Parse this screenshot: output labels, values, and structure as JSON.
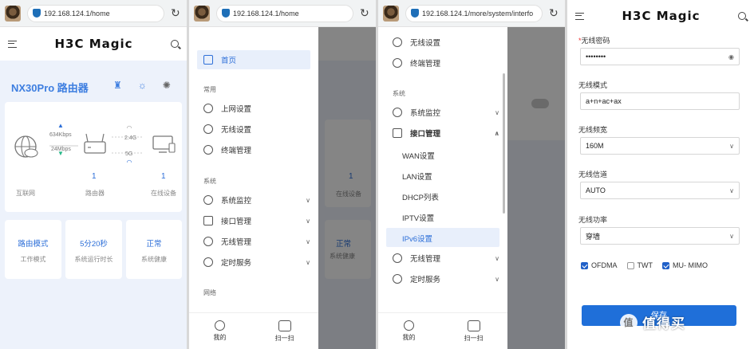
{
  "panel1": {
    "url": "192.168.124.1/home",
    "logo": "H3C Magic",
    "router_name": "NX30Pro 路由器",
    "upload_speed": "634Kbps",
    "download_speed": "24Mbps",
    "band_24": "2.4G",
    "band_5": "5G",
    "router_count": "1",
    "device_count": "1",
    "labels": {
      "internet": "互联网",
      "router": "路由器",
      "online": "在线设备"
    },
    "stats": [
      {
        "value": "路由模式",
        "label": "工作模式"
      },
      {
        "value": "5分20秒",
        "label": "系统运行时长"
      },
      {
        "value": "正常",
        "label": "系统健康"
      }
    ]
  },
  "panel2": {
    "url": "192.168.124.1/home",
    "menu_home": "首页",
    "section_common": "常用",
    "common_items": [
      "上网设置",
      "无线设置",
      "终端管理"
    ],
    "section_system": "系统",
    "system_items": [
      "系统监控",
      "接口管理",
      "无线管理",
      "定时服务"
    ],
    "section_network": "网络",
    "bottom_nav": [
      "我的",
      "扫一扫"
    ],
    "bg_device_count": "1",
    "bg_online_label": "在线设备",
    "bg_stat_value": "正常",
    "bg_stat_label": "系统健康"
  },
  "panel3": {
    "url": "192.168.124.1/more/system/interfo",
    "top_items": [
      "无线设置",
      "终端管理"
    ],
    "section_system": "系统",
    "monitor": "系统监控",
    "interface_mgmt": "接口管理",
    "sub_items": [
      "WAN设置",
      "LAN设置",
      "DHCP列表",
      "IPTV设置",
      "IPv6设置"
    ],
    "wireless_mgmt": "无线管理",
    "timer_service": "定时服务",
    "bottom_nav": [
      "我的",
      "扫一扫"
    ]
  },
  "panel4": {
    "logo": "H3C Magic",
    "password_label": "无线密码",
    "password_value": "••••••••",
    "mode_label": "无线模式",
    "mode_value": "a+n+ac+ax",
    "bandwidth_label": "无线频宽",
    "bandwidth_value": "160M",
    "channel_label": "无线信道",
    "channel_value": "AUTO",
    "power_label": "无线功率",
    "power_value": "穿墙",
    "ofdma": "OFDMA",
    "twt": "TWT",
    "mumimo": "MU- MIMO",
    "save": "保存",
    "watermark": "值得买",
    "watermark_badge": "值"
  }
}
